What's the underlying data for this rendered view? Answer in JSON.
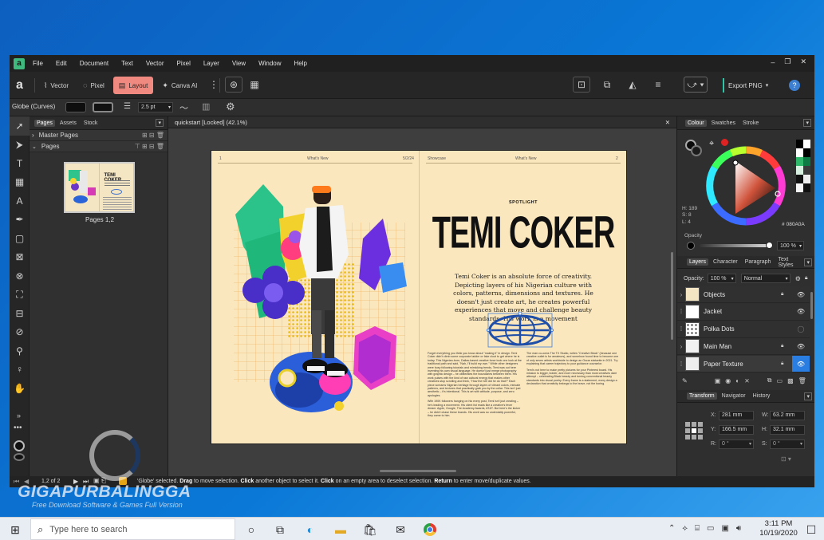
{
  "app": {
    "logo": "affinity-logo-icon"
  },
  "menu": [
    "File",
    "Edit",
    "Document",
    "Text",
    "Vector",
    "Pixel",
    "Layer",
    "View",
    "Window",
    "Help"
  ],
  "window_controls": {
    "minimize": "–",
    "restore": "❐",
    "close": "✕"
  },
  "personas": [
    {
      "label": "Vector",
      "icon": "vector-persona-icon"
    },
    {
      "label": "Pixel",
      "icon": "pixel-persona-icon"
    },
    {
      "label": "Layout",
      "icon": "layout-persona-icon",
      "active": true
    },
    {
      "label": "Canva AI",
      "icon": "canva-ai-icon"
    }
  ],
  "export_label": "Export PNG",
  "help_glyph": "?",
  "context": {
    "selection": "Globe (Curves)",
    "stroke_width": "2.5 pt"
  },
  "pages_panel": {
    "tabs": [
      "Pages",
      "Assets",
      "Stock"
    ],
    "master_pages": "Master Pages",
    "pages": "Pages",
    "thumb_label": "Pages 1,2",
    "thumb_title": "TEMI COKER"
  },
  "document": {
    "tab_title": "quickstart [Locked] (42.1%)",
    "close_glyph": "✕",
    "left_page": {
      "number": "1",
      "header": "What's New",
      "date": "5/2/24"
    },
    "right_page": {
      "label": "Showcase",
      "header": "What's New",
      "number": "2"
    },
    "spotlight": "SPOTLIGHT",
    "headline": "TEMI COKER",
    "intro": "Temi Coker is an absolute force of creativity. Depicting layers of his Nigerian culture with colors, patterns, dimensions and textures. He doesn't just create art, he creates powerful experiences that move and challenge beauty standards. His work is a movement",
    "col1": "Forget everything you think you know about \"making it\" in design. Temi Coker didn't climb some corporate ladder or fake clout to get where he is today. This Nigerian-born, Dallas-based creative force took one look at the traditional path and said, \"Nah, I'll build my own.\" While other designers were busy following tutorials and mimicking trends, Temi was out here inventing his own visual language. He doesn't just merge photography with graphic design – he obliterates the boundaries between them. His work pulses with the kind of raw cultural energy that makes other creatives stop scrolling and think, \"How the hell did he do that?\" Each piece screams Nigerian heritage through layers of vibrant colors, intricate patterns, and textures that practically grab you by the collar. This isn't just aesthetic – it's intentional. This is art with attitude, purpose, and zero apologies.",
    "col1b": "With 190K followers hanging on his every post, Temi isn't just creating – he's leading a movement. His client list reads like a creative's fever dream: Apple, Google, The Academy Awards, AT&T. But here's the kicker – he didn't chase these brands. His work was so undeniably powerful, they came to him.",
    "col2": "The man co-owns The TX Studio, writes \"Creative Block\" (because one creative outlet is for amateurs), and somehow found time to become one of only seven artists worldwide to design an Oscar statuette in 2021. Try explaining that career trajectory to your guidance counselor.",
    "col2b": "Temi's not here to make pretty pictures for your Pinterest board. His mission is bigger, bolder, and more necessary than most creatives dare attempt – celebrating Black beauty and turning conventional beauty standards into visual poetry. Every frame is a statement, every design a declaration that creativity belongs to the brave, not the boring."
  },
  "colour_panel": {
    "tabs": [
      "Colour",
      "Swatches",
      "Stroke"
    ],
    "h": "H: 189",
    "s": "S: 8",
    "l": "L: 4",
    "hex": "080A0A",
    "opacity_label": "Opacity",
    "opacity_value": "100 %"
  },
  "layers_panel": {
    "tabs": [
      "Layers",
      "Character",
      "Paragraph",
      "Text Styles"
    ],
    "opacity_label": "Opacity:",
    "opacity_value": "100 %",
    "blend_mode": "Normal",
    "layers": [
      {
        "name": "Objects",
        "expander": "›",
        "thumb": "objects-thumb",
        "locked": true,
        "visible": true
      },
      {
        "name": "Jacket",
        "expander": "",
        "thumb": "jacket-thumb",
        "locked": false,
        "visible": true
      },
      {
        "name": "Polka Dots",
        "expander": "",
        "thumb": "polka-dots-thumb",
        "locked": false,
        "visible": false
      },
      {
        "name": "Main Man",
        "expander": "›",
        "thumb": "main-man-thumb",
        "locked": true,
        "visible": true
      },
      {
        "name": "Paper Texture",
        "expander": "",
        "thumb": "paper-texture-thumb",
        "locked": true,
        "visible": true,
        "selected": true
      }
    ]
  },
  "transform_panel": {
    "tabs": [
      "Transform",
      "Navigator",
      "History"
    ],
    "x_label": "X:",
    "x": "281 mm",
    "y_label": "Y:",
    "y": "166.5 mm",
    "w_label": "W:",
    "w": "63.2 mm",
    "h_label": "H:",
    "h": "32.1 mm",
    "r_label": "R:",
    "r": "0 °",
    "s_label": "S:",
    "s": "0 °"
  },
  "status": {
    "page": "1,2 of 2",
    "message_parts": [
      {
        "t": "'Globe' selected. ",
        "b": false
      },
      {
        "t": "Drag",
        "b": true
      },
      {
        "t": " to move selection. ",
        "b": false
      },
      {
        "t": "Click",
        "b": true
      },
      {
        "t": " another object to select it. ",
        "b": false
      },
      {
        "t": "Click",
        "b": true
      },
      {
        "t": " on an empty area to deselect selection. ",
        "b": false
      },
      {
        "t": "Return",
        "b": true
      },
      {
        "t": " to enter move/duplicate values.",
        "b": false
      }
    ]
  },
  "watermark": {
    "title": "GIGAPURBALINGGA",
    "subtitle": "Free Download Software & Games Full Version"
  },
  "taskbar": {
    "search_placeholder": "Type here to search",
    "time": "3:11 PM",
    "date": "10/19/2020",
    "icons": [
      "windows-start-icon",
      "search-icon",
      "task-view-icon",
      "multitasking-icon",
      "edge-icon",
      "file-explorer-icon",
      "store-icon",
      "mail-icon",
      "chrome-icon"
    ]
  },
  "colors": {
    "accent_layout": "#f08a80",
    "export_accent": "#2ec4a5",
    "selection_blue": "#2a7de1"
  }
}
